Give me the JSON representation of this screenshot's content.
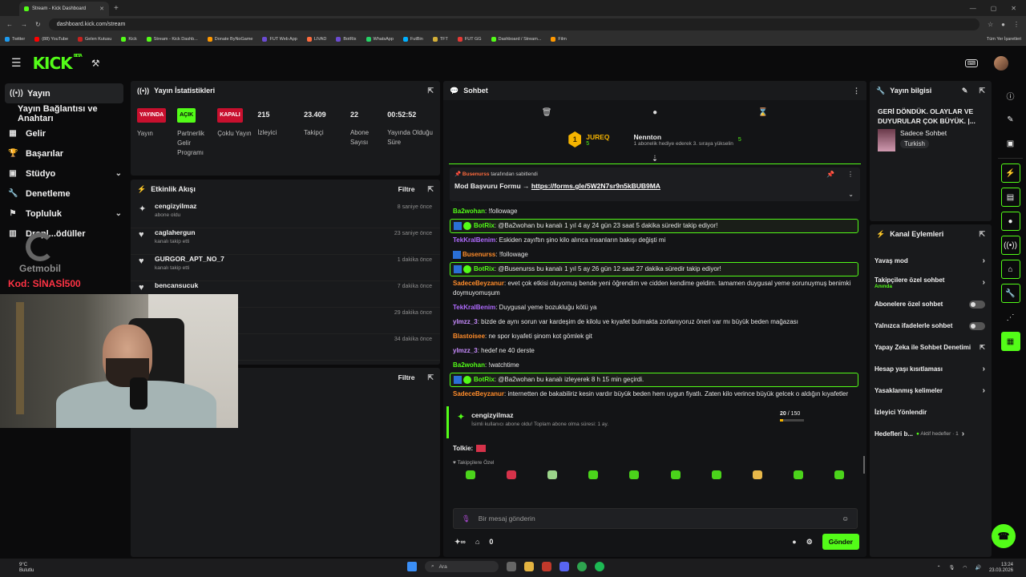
{
  "browser": {
    "tab_title": "Stream - Kick Dashboard",
    "url": "dashboard.kick.com/stream",
    "bookmarks": [
      "Twitter",
      "(88) YouTube",
      "Gelen Kutusu",
      "Kick",
      "Stream - Kick Dashb...",
      "Donate ByNoGame",
      "FUT Web App",
      "LIVAD",
      "BotRix",
      "WhatsApp",
      "FutBin",
      "TFT",
      "FUT GG",
      "Dashboard / Stream...",
      "Film"
    ],
    "all_bookmarks": "Tüm Yer İşaretleri"
  },
  "header": {
    "logo": "KICK",
    "beta": "BETA"
  },
  "nav": {
    "items": [
      {
        "label": "Yayın",
        "icon": "broadcast-icon"
      },
      {
        "label": "Yayın Bağlantısı ve Anahtarı"
      },
      {
        "label": "Gelir",
        "icon": "revenue-icon"
      },
      {
        "label": "Başarılar",
        "icon": "trophy-icon"
      },
      {
        "label": "Stüdyo",
        "icon": "studio-icon"
      },
      {
        "label": "Denetleme",
        "icon": "wrench-icon"
      },
      {
        "label": "Topluluk",
        "icon": "community-icon"
      },
      {
        "label": "Dropl...ödüller",
        "icon": "drops-icon"
      }
    ]
  },
  "overlay": {
    "watermark": "Getmobil",
    "code": "Kod: SİNASİ500"
  },
  "stats": {
    "title": "Yayın İstatistikleri",
    "items": [
      {
        "badge": "YAYINDA",
        "label": "Yayın",
        "color": "red"
      },
      {
        "badge": "AÇIK",
        "label": "Partnerlik Gelir Programı",
        "color": "green"
      },
      {
        "badge": "KAPALI",
        "label": "Çoklu Yayın",
        "color": "red"
      },
      {
        "value": "215",
        "label": "İzleyici"
      },
      {
        "value": "23.409",
        "label": "Takipçi"
      },
      {
        "value": "22",
        "label": "Abone Sayısı"
      },
      {
        "value": "00:52:52",
        "label": "Yayında Olduğu Süre"
      }
    ]
  },
  "activity": {
    "title": "Etkinlik Akışı",
    "filter": "Filtre",
    "rows": [
      {
        "name": "cengizyilmaz",
        "sub": "abone oldu",
        "time": "8 saniye önce",
        "icon": "sparkle-icon"
      },
      {
        "name": "caglahergun",
        "sub": "kanalı takip etti",
        "time": "23 saniye önce",
        "icon": "heart-icon"
      },
      {
        "name": "GURGOR_APT_NO_7",
        "sub": "kanalı takip etti",
        "time": "1 dakika önce",
        "icon": "heart-icon"
      },
      {
        "name": "bencansucuk",
        "sub": "",
        "time": "7 dakika önce",
        "icon": "heart-icon"
      },
      {
        "name": "",
        "sub": "",
        "time": "29 dakika önce",
        "icon": ""
      },
      {
        "name": "",
        "sub": "",
        "time": "34 dakika önce",
        "icon": ""
      }
    ]
  },
  "lowpanel": {
    "filter": "Filtre"
  },
  "chat": {
    "title": "Sohbet",
    "gifters": [
      {
        "name": "JUREQ",
        "count": "5",
        "rank": "1"
      },
      {
        "name": "Nennton",
        "count": "5",
        "note": "1 abonelik hediye ederek 3. sıraya yükselin"
      }
    ],
    "pinned": {
      "by_user": "Busenurss",
      "by_text": "tarafından sabitlendi",
      "text": "Mod Başvuru Formu →",
      "link": "https://forms.gle/5W2N7sr9n5kBUB9MA"
    },
    "messages": [
      {
        "user": "Ba2wohan",
        "color": "#53fc18",
        "text": "!followage",
        "bot": false
      },
      {
        "user": "BotRix",
        "color": "#53fc18",
        "text": "@Ba2wohan bu kanalı 1 yıl 4 ay 24 gün 23 saat 5 dakika süredir takip ediyor!",
        "bot": true
      },
      {
        "user": "TekKralBenim",
        "color": "#b06bff",
        "text": "Eskiden zayıftın şino kilo alınca insanların bakışı değişti mi",
        "bot": false
      },
      {
        "user": "Busenurss",
        "color": "#ff8c2a",
        "text": "!followage",
        "bot": false,
        "badge": true
      },
      {
        "user": "BotRix",
        "color": "#53fc18",
        "text": "@Busenurss bu kanalı 1 yıl 5 ay 26 gün 12 saat 27 dakika süredir takip ediyor!",
        "bot": true
      },
      {
        "user": "SadeceBeyzanur",
        "color": "#ff8c2a",
        "text": "evet çok etkisi oluyomuş bende yeni öğrendim ve cidden kendime geldim. tamamen duygusal yeme sorunuymuş benimki doymuyomuşum",
        "bot": false
      },
      {
        "user": "TekKralBenim",
        "color": "#b06bff",
        "text": "Duygusal yeme bozukluğu kötü ya",
        "bot": false
      },
      {
        "user": "ylmzz_3",
        "color": "#c88cff",
        "text": "bizde de aynı sorun var kardeşim de kilolu ve kıyafet bulmakta zorlanıyoruz öneri var mı büyük beden mağazası",
        "bot": false
      },
      {
        "user": "Blastoisee",
        "color": "#ff8c2a",
        "text": "ne spor kıyafeti şinom kot gömlek git",
        "bot": false
      },
      {
        "user": "ylmzz_3",
        "color": "#c88cff",
        "text": "hedef ne 40 derste",
        "bot": false
      },
      {
        "user": "Ba2wohan",
        "color": "#53fc18",
        "text": "!watchtime",
        "bot": false
      },
      {
        "user": "BotRix",
        "color": "#53fc18",
        "text": "@Ba2wohan bu kanalı izleyerek 8 h 15 min geçirdi.",
        "bot": true
      },
      {
        "user": "SadeceBeyzanur",
        "color": "#ff8c2a",
        "text": "internetten de bakabiliriz kesin vardır büyük beden hem uygun fiyatlı. Zaten kilo verince büyük gelcek o aldığın kıyafetler",
        "bot": false
      }
    ],
    "sub_card": {
      "name": "cengizyilmaz",
      "desc": "İsimli kullanıcı abone oldu! Toplam abone olma süresi: 1 ay.",
      "progress": "20",
      "goal": "/ 150",
      "progress_fraction": 0.133
    },
    "talkie": "Tolkie:",
    "emote_label": "Takipçilere Özel",
    "input_placeholder": "Bir mesaj gönderin",
    "footer_count": "0",
    "send": "Gönder"
  },
  "info": {
    "title": "Yayın bilgisi",
    "stream_title": "GERİ DÖNDÜK. OLAYLAR VE DUYURULAR ÇOK BÜYÜK. |...",
    "category": "Sadece Sohbet",
    "language": "Turkish"
  },
  "actions": {
    "title": "Kanal Eylemleri",
    "items": [
      {
        "label": "Yavaş mod",
        "type": "chevron"
      },
      {
        "label": "Takipçilere özel sohbet",
        "sub": "Anında",
        "type": "chevron"
      },
      {
        "label": "Abonelere özel sohbet",
        "type": "toggle"
      },
      {
        "label": "Yalnızca ifadelerle sohbet",
        "type": "toggle"
      },
      {
        "label": "Yapay Zeka ile Sohbet Denetimi",
        "type": "external"
      },
      {
        "label": "Hesap yaşı kısıtlaması",
        "type": "chevron"
      },
      {
        "label": "Yasaklanmış kelimeler",
        "type": "chevron"
      },
      {
        "label": "İzleyici Yönlendir",
        "type": "none"
      },
      {
        "label": "Hedefleri b...",
        "type": "chevron",
        "meta": "Aktif hedefler · 1"
      }
    ]
  },
  "taskbar": {
    "weather_temp": "9°C",
    "weather_desc": "Bulutlu",
    "search": "Ara",
    "time": "13:24",
    "date": "23.03.2026"
  },
  "colors": {
    "accent": "#53fc18",
    "live": "#c8102e",
    "panel": "#191a1c"
  }
}
